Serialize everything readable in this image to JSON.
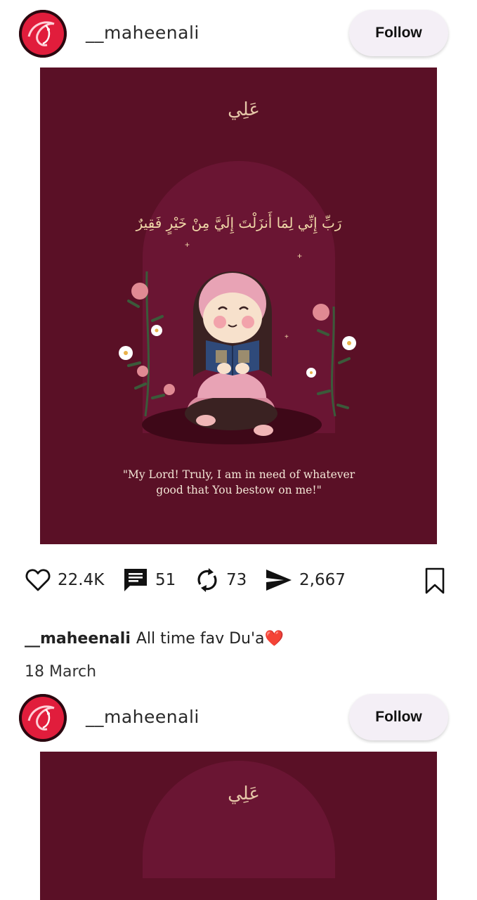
{
  "posts": [
    {
      "username": "__maheenali",
      "follow_label": "Follow",
      "image": {
        "background_color": "#5a1026",
        "arch_color": "#6a1533",
        "logo_glyph": "عَلِي",
        "arabic_verse": "رَبِّ إِنِّي لِمَا أَنزَلْتَ إِلَيَّ مِنْ خَيْرٍ فَقِيرٌ",
        "quote_line1": "\"My Lord! Truly, I am in need of whatever",
        "quote_line2": "good that You bestow on me!\""
      },
      "stats": {
        "likes": "22.4K",
        "comments": "51",
        "reposts": "73",
        "shares": "2,667"
      },
      "caption_user": "__maheenali",
      "caption_text": "All time fav Du'a❤️",
      "date": "18 March"
    },
    {
      "username": "__maheenali",
      "follow_label": "Follow"
    }
  ],
  "icons": {
    "like": "heart-outline-icon",
    "comment": "comment-icon",
    "repost": "repost-icon",
    "share": "send-icon",
    "save": "bookmark-icon"
  }
}
